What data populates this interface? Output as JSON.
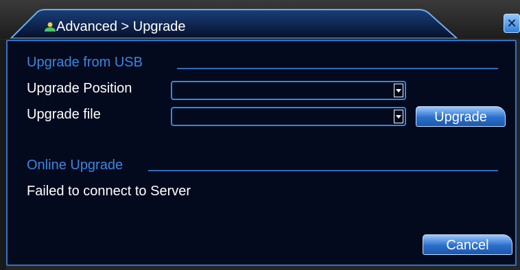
{
  "window": {
    "title": "Advanced > Upgrade",
    "close_label": "✕"
  },
  "usb_section": {
    "heading": "Upgrade from USB",
    "position_label": "Upgrade Position",
    "position_value": "",
    "file_label": "Upgrade file",
    "file_value": "",
    "upgrade_button": "Upgrade"
  },
  "online_section": {
    "heading": "Online Upgrade",
    "status": "Failed to connect to Server"
  },
  "footer": {
    "cancel_button": "Cancel"
  },
  "colors": {
    "panel_bg": "#040a1e",
    "accent_blue": "#2f74c6",
    "section_text": "#3d86e0"
  }
}
